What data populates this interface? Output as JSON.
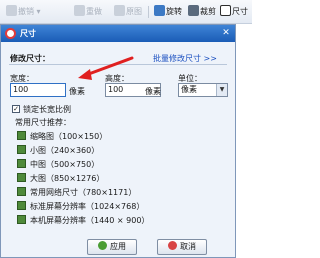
{
  "toolbar": {
    "undo_label": "撤销",
    "redo_label": "重做",
    "original_label": "原图",
    "rotate_label": "旋转",
    "crop_label": "裁剪",
    "size_label": "尺寸"
  },
  "dialog": {
    "title": "尺寸",
    "section_title": "修改尺寸：",
    "batch_link": "批量修改尺寸 >>",
    "width_label": "宽度：",
    "width_value": "100",
    "width_unit": "像素",
    "height_label": "高度：",
    "height_value": "100",
    "height_unit": "像素",
    "unit_label": "单位：",
    "unit_value": "像素",
    "lock_ratio_label": "锁定长宽比例",
    "lock_ratio_checked": true,
    "presets_label": "常用尺寸推荐：",
    "presets": [
      {
        "label": "缩略图（100×150）"
      },
      {
        "label": "小图（240×360）"
      },
      {
        "label": "中图（500×750）"
      },
      {
        "label": "大图（850×1276）"
      },
      {
        "label": "常用网络尺寸（780×1171）"
      },
      {
        "label": "标准屏幕分辨率（1024×768）"
      },
      {
        "label": "本机屏幕分辨率（1440 × 900）"
      }
    ],
    "ok_label": "应用",
    "cancel_label": "取消",
    "close_glyph": "✕"
  },
  "colors": {
    "titlebar": "#2b6fc6",
    "link": "#1a4fc0",
    "annotation_arrow": "#e02020"
  }
}
